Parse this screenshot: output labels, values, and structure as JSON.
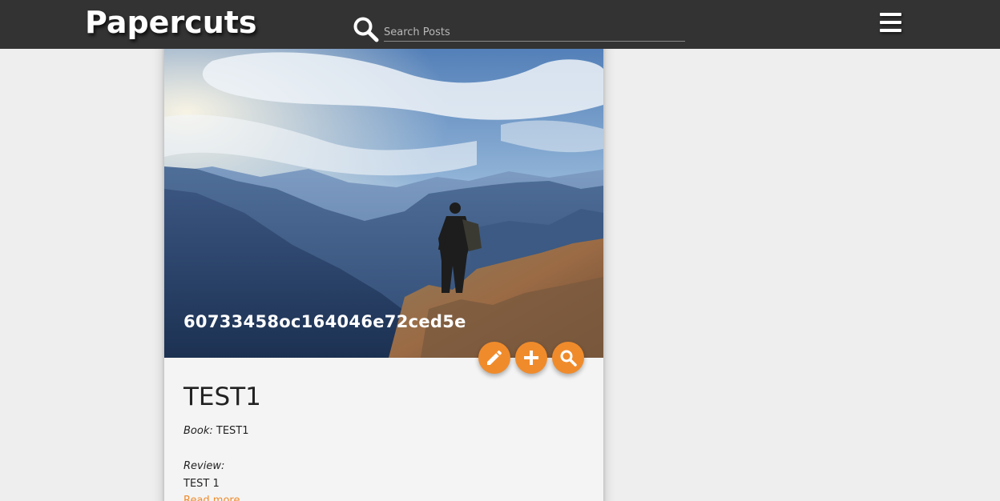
{
  "brand": {
    "name": "Papercuts"
  },
  "search": {
    "placeholder": "Search Posts",
    "icon": "search-icon"
  },
  "menu": {
    "icon": "hamburger-menu-icon"
  },
  "post": {
    "image_title": "60733458oc164046e72ced5e",
    "image_description": "hiker-on-mountain-ridge",
    "actions": [
      {
        "icon": "pencil-icon",
        "label": "Edit"
      },
      {
        "icon": "plus-icon",
        "label": "Add"
      },
      {
        "icon": "magnifier-icon",
        "label": "View"
      }
    ],
    "title": "TEST1",
    "book_label": "Book:",
    "book_value": "TEST1",
    "review_label": "Review:",
    "review_text": "TEST 1",
    "read_more": "Read more"
  },
  "colors": {
    "navbar": "#333333",
    "background": "#eeeeee",
    "card": "#f4f4f4",
    "accent": "#f08b2b"
  }
}
